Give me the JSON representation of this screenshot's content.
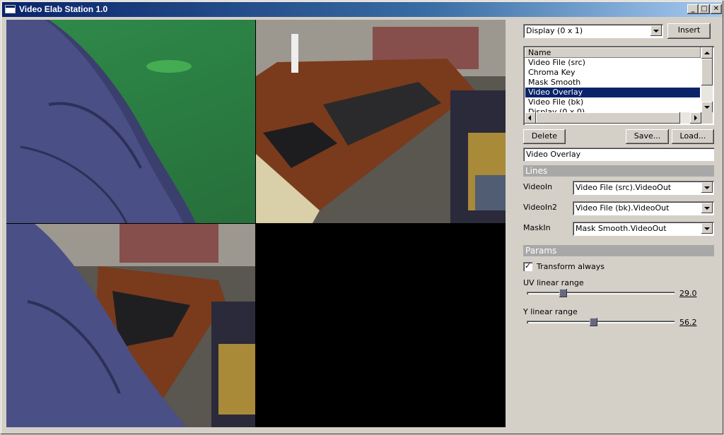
{
  "window": {
    "title": "Video Elab Station 1.0"
  },
  "titlebar_buttons": {
    "minimize": "_",
    "maximize": "□",
    "close": "✕"
  },
  "toolbar": {
    "display_select": "Display (0 x 1)",
    "insert_label": "Insert"
  },
  "filter_list": {
    "header": "Name",
    "items": [
      {
        "label": "Video File (src)",
        "selected": false
      },
      {
        "label": "Chroma Key",
        "selected": false
      },
      {
        "label": "Mask Smooth",
        "selected": false
      },
      {
        "label": "Video Overlay",
        "selected": true
      },
      {
        "label": "Video File (bk)",
        "selected": false
      },
      {
        "label": "Display (0 x 0)",
        "selected": false
      }
    ]
  },
  "actions": {
    "delete_label": "Delete",
    "save_label": "Save...",
    "load_label": "Load..."
  },
  "selected_name": "Video Overlay",
  "lines": {
    "title": "Lines",
    "rows": [
      {
        "label": "VideoIn",
        "value": "Video File (src).VideoOut"
      },
      {
        "label": "VideoIn2",
        "value": "Video File (bk).VideoOut"
      },
      {
        "label": "MaskIn",
        "value": "Mask Smooth.VideoOut"
      }
    ]
  },
  "params": {
    "title": "Params",
    "transform_always": {
      "label": "Transform always",
      "checked": true,
      "mark": "✓"
    },
    "sliders": [
      {
        "label": "UV linear range",
        "value": "29.0",
        "fraction": 0.23
      },
      {
        "label": "Y linear range",
        "value": "56.2",
        "fraction": 0.45
      }
    ]
  },
  "colors": {
    "selection": "#0a246a",
    "titlebar": "#0a246a",
    "section_header": "#a8a8a8"
  }
}
